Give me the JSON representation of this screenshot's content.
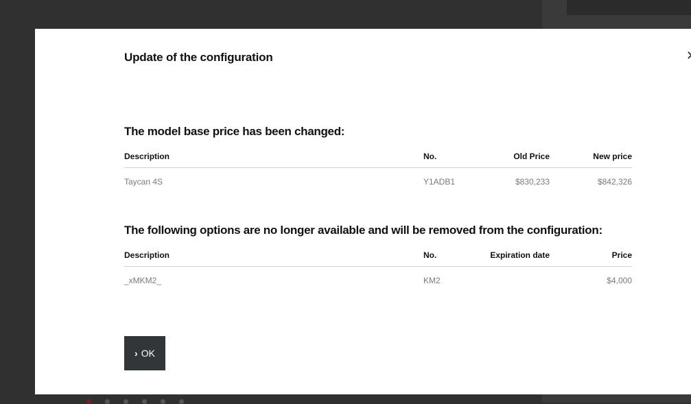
{
  "dialog": {
    "title": "Update of the configuration",
    "close_icon": "close-icon",
    "base_price_section": {
      "title": "The model base price has been changed:",
      "columns": [
        "Description",
        "No.",
        "Old Price",
        "New price"
      ],
      "rows": [
        {
          "description": "Taycan 4S",
          "number": "Y1ADB1",
          "old_price": "$830,233",
          "new_price": "$842,326"
        }
      ]
    },
    "removed_options_section": {
      "title": "The following options are no longer available and will be removed from the configuration:",
      "columns": [
        "Description",
        "No.",
        "Expiration date",
        "Price"
      ],
      "rows": [
        {
          "description": "_xMKM2_",
          "number": "KM2",
          "expiration_date": "",
          "price": "$4,000"
        }
      ]
    },
    "ok_button": {
      "icon": "chevron-right-icon",
      "label": "OK"
    }
  }
}
